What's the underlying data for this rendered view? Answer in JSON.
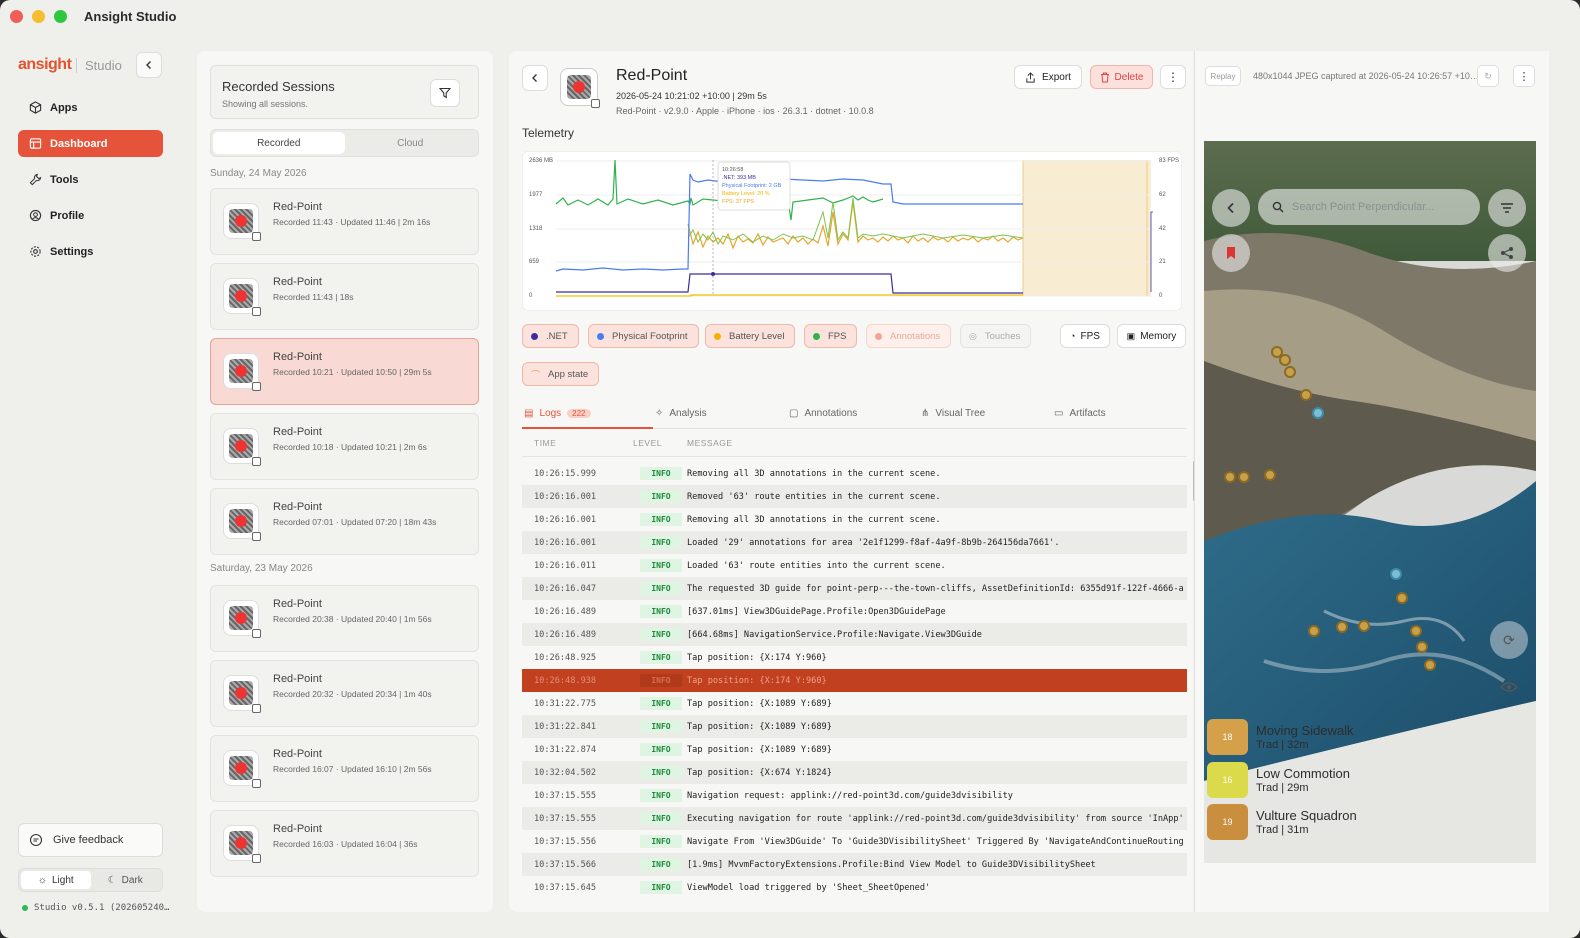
{
  "app": {
    "title": "Ansight Studio"
  },
  "sidebar": {
    "logo": "ansight",
    "logo_sub": "Studio",
    "items": [
      {
        "label": "Apps",
        "icon": "cube-icon"
      },
      {
        "label": "Dashboard",
        "icon": "dashboard-icon",
        "active": true
      },
      {
        "label": "Tools",
        "icon": "wrench-icon"
      },
      {
        "label": "Profile",
        "icon": "user-icon"
      },
      {
        "label": "Settings",
        "icon": "gear-icon"
      }
    ],
    "feedback": "Give feedback",
    "theme_light": "Light",
    "theme_dark": "Dark",
    "version": "Studio v0.5.1 (202605240…"
  },
  "sessions": {
    "title": "Recorded Sessions",
    "subtitle": "Showing all sessions.",
    "seg_recorded": "Recorded",
    "seg_cloud": "Cloud",
    "day1": "Sunday, 24 May 2026",
    "day2": "Saturday, 23 May 2026",
    "cards": [
      {
        "name": "Red-Point",
        "meta": "Recorded 11:43 · Updated 11:46 | 2m 16s"
      },
      {
        "name": "Red-Point",
        "meta": "Recorded 11:43 | 18s"
      },
      {
        "name": "Red-Point",
        "meta": "Recorded 10:21 · Updated 10:50 | 29m 5s"
      },
      {
        "name": "Red-Point",
        "meta": "Recorded 10:18 · Updated 10:21 | 2m 6s"
      },
      {
        "name": "Red-Point",
        "meta": "Recorded 07:01 · Updated 07:20 | 18m 43s"
      },
      {
        "name": "Red-Point",
        "meta": "Recorded 20:38 · Updated 20:40 | 1m 56s"
      },
      {
        "name": "Red-Point",
        "meta": "Recorded 20:32 · Updated 20:34 | 1m 40s"
      },
      {
        "name": "Red-Point",
        "meta": "Recorded 16:07 · Updated 16:10 | 2m 56s"
      },
      {
        "name": "Red-Point",
        "meta": "Recorded 16:03 · Updated 16:04 | 36s"
      }
    ]
  },
  "detail": {
    "title": "Red-Point",
    "meta1": "2026-05-24 10:21:02 +10:00   |   29m 5s",
    "meta2": "Red-Point · v2.9.0 · Apple · iPhone · ios · 26.3.1 · dotnet · 10.0.8",
    "export": "Export",
    "delete": "Delete",
    "telemetry": "Telemetry",
    "tooltip": {
      "time": "10:26:58",
      "net": ".NET: 393 MB",
      "pf": "Physical Footprint: 2 GB",
      "bat": "Battery Level: 20 %",
      "fps": "FPS: 37 FPS"
    },
    "y_left": [
      "2636 MB",
      "1977",
      "1318",
      "659",
      "0"
    ],
    "y_right": [
      "83 FPS",
      "62",
      "42",
      "21",
      "0"
    ],
    "pills": [
      ".NET",
      "Physical Footprint",
      "Battery Level",
      "FPS",
      "Annotations",
      "Touches"
    ],
    "fps_btn": "FPS",
    "memory_btn": "Memory",
    "app_state": "App state",
    "tabs": [
      "Logs",
      "Analysis",
      "Annotations",
      "Visual Tree",
      "Artifacts"
    ],
    "logs_count": "222",
    "cols": [
      "TIME",
      "LEVEL",
      "MESSAGE"
    ]
  },
  "logs": [
    {
      "t": "10:26:15.999",
      "l": "INFO",
      "m": "Removing all 3D annotations in the current scene."
    },
    {
      "t": "10:26:16.001",
      "l": "INFO",
      "m": "Removed '63' route entities in the current scene."
    },
    {
      "t": "10:26:16.001",
      "l": "INFO",
      "m": "Removing all 3D annotations in the current scene."
    },
    {
      "t": "10:26:16.001",
      "l": "INFO",
      "m": "Loaded '29' annotations for area '2e1f1299-f8af-4a9f-8b9b-264156da7661'."
    },
    {
      "t": "10:26:16.011",
      "l": "INFO",
      "m": "Loaded '63' route entities into the current scene."
    },
    {
      "t": "10:26:16.047",
      "l": "INFO",
      "m": "The requested 3D guide for point-perp---the-town-cliffs, AssetDefinitionId: 6355d91f-122f-4666-a"
    },
    {
      "t": "10:26:16.489",
      "l": "INFO",
      "m": "[637.01ms] View3DGuidePage.Profile:Open3DGuidePage"
    },
    {
      "t": "10:26:16.489",
      "l": "INFO",
      "m": "[664.68ms] NavigationService.Profile:Navigate.View3DGuide"
    },
    {
      "t": "10:26:48.925",
      "l": "INFO",
      "m": "Tap position: {X:174 Y:960}"
    },
    {
      "t": "10:26:48.938",
      "l": "INFO",
      "m": "Tap position: {X:174 Y:960}"
    },
    {
      "t": "10:31:22.775",
      "l": "INFO",
      "m": "Tap position: {X:1089 Y:689}"
    },
    {
      "t": "10:31:22.841",
      "l": "INFO",
      "m": "Tap position: {X:1089 Y:689}"
    },
    {
      "t": "10:31:22.874",
      "l": "INFO",
      "m": "Tap position: {X:1089 Y:689}"
    },
    {
      "t": "10:32:04.502",
      "l": "INFO",
      "m": "Tap position: {X:674 Y:1824}"
    },
    {
      "t": "10:37:15.555",
      "l": "INFO",
      "m": "Navigation request: applink://red-point3d.com/guide3dvisibility"
    },
    {
      "t": "10:37:15.555",
      "l": "INFO",
      "m": "Executing navigation for route 'applink://red-point3d.com/guide3dvisibility' from source 'InApp'"
    },
    {
      "t": "10:37:15.556",
      "l": "INFO",
      "m": "Navigate From 'View3DGuide' To 'Guide3DVisibilitySheet' Triggered By 'NavigateAndContinueRouting"
    },
    {
      "t": "10:37:15.566",
      "l": "INFO",
      "m": "[1.9ms] MvvmFactoryExtensions.Profile:Bind View Model to Guide3DVisibilitySheet"
    },
    {
      "t": "10:37:15.645",
      "l": "INFO",
      "m": "ViewModel load triggered by 'Sheet_SheetOpened'"
    }
  ],
  "replay": {
    "btn": "Replay",
    "info": "480x1044 JPEG captured at 2026-05-24 10:26:57 +10…",
    "search_placeholder": "Search Point Perpendicular...",
    "routes": [
      {
        "grade": "18",
        "name": "Moving Sidewalk",
        "sub": "Trad | 32m",
        "color": "#d4a04a"
      },
      {
        "grade": "16",
        "name": "Low Commotion",
        "sub": "Trad | 29m",
        "color": "#dada4a"
      },
      {
        "grade": "19",
        "name": "Vulture Squadron",
        "sub": "Trad | 31m",
        "color": "#c98f3e"
      }
    ]
  },
  "colors": {
    "accent": "#e5533a",
    "net": "#3b5bdb",
    "pf": "#4a7cf0",
    "battery": "#f0b400",
    "fps": "#2fb34a"
  }
}
